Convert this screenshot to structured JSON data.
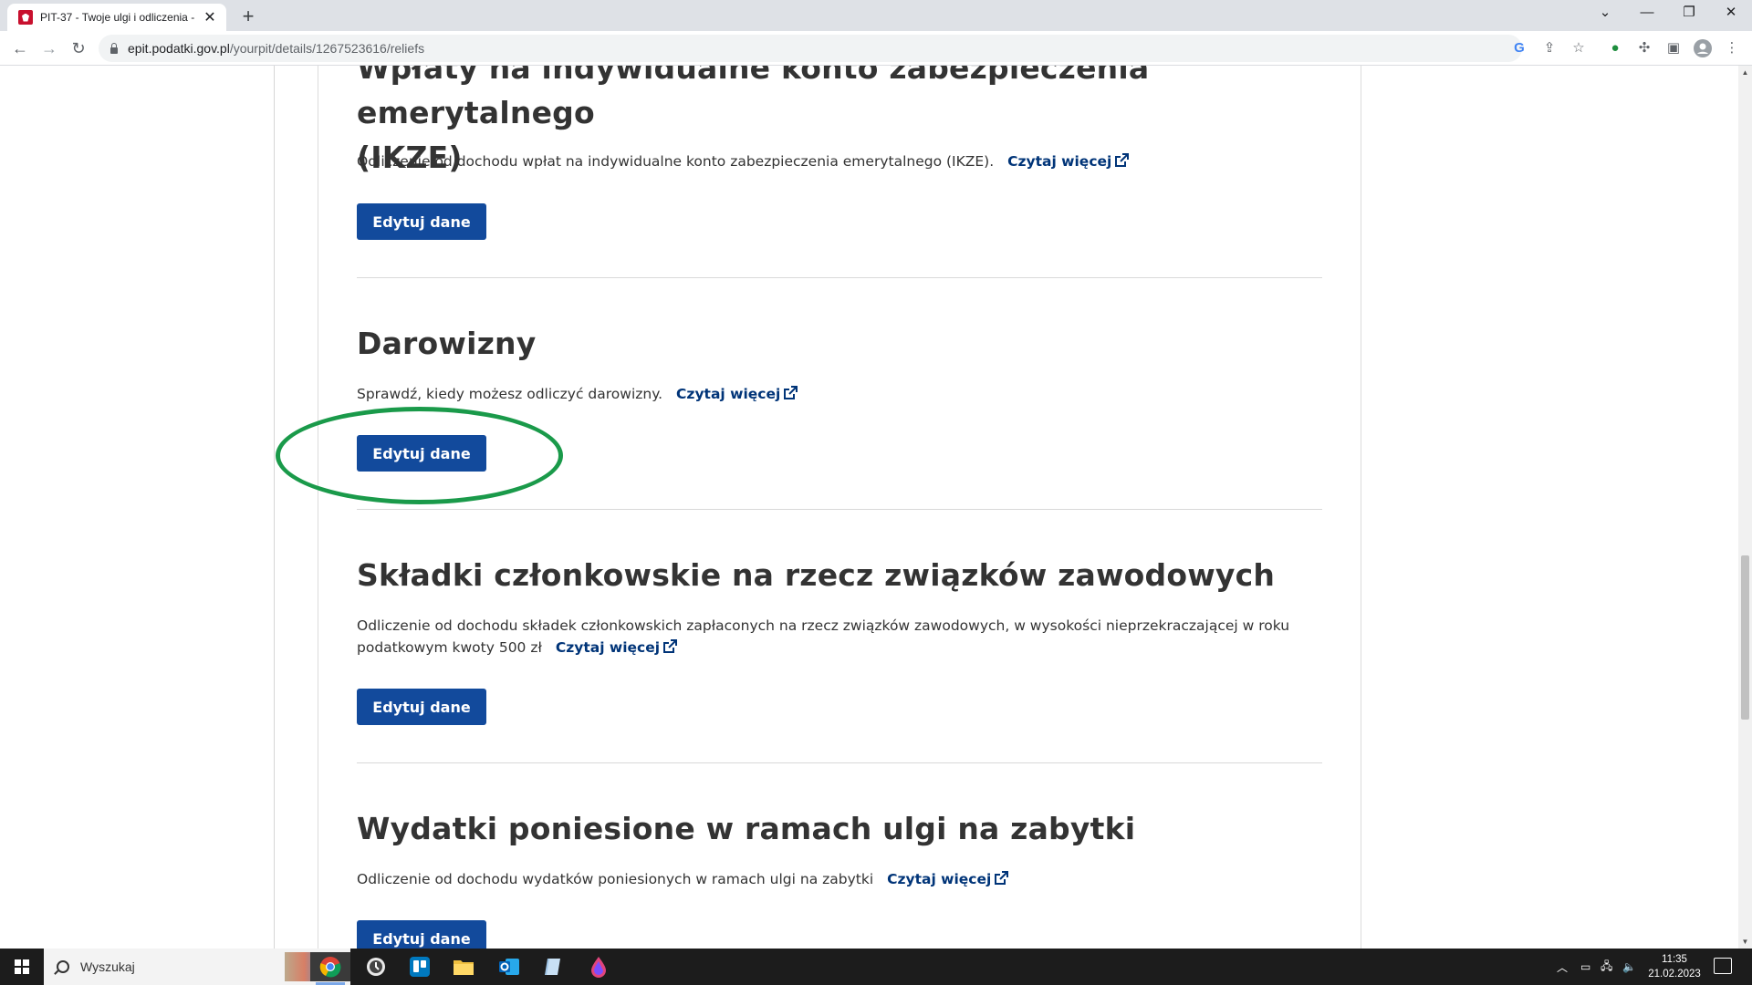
{
  "browser": {
    "tab_title": "PIT-37 - Twoje ulgi i odliczenia -",
    "tab_close": "✕",
    "new_tab": "+",
    "url_host": "epit.podatki.gov.pl",
    "url_path": "/yourpit/details/1267523616/reliefs"
  },
  "sections": [
    {
      "heading_line1": "Wpłaty na indywidualne konto zabezpieczenia emerytalnego",
      "heading_line2": "(IKZE)",
      "description": "Odliczenie od dochodu wpłat na indywidualne konto zabezpieczenia emerytalnego (IKZE).",
      "read_more": "Czytaj więcej",
      "button": "Edytuj dane"
    },
    {
      "heading": "Darowizny",
      "description": "Sprawdź, kiedy możesz odliczyć darowizny.",
      "read_more": "Czytaj więcej",
      "button": "Edytuj dane"
    },
    {
      "heading": "Składki członkowskie na rzecz związków zawodowych",
      "description_line1": "Odliczenie od dochodu składek członkowskich zapłaconych na rzecz związków zawodowych, w wysokości nieprzekraczającej w roku",
      "description_line2": "podatkowym kwoty 500 zł",
      "read_more": "Czytaj więcej",
      "button": "Edytuj dane"
    },
    {
      "heading": "Wydatki poniesione w ramach ulgi na zabytki",
      "description": "Odliczenie od dochodu wydatków poniesionych w ramach ulgi na zabytki",
      "read_more": "Czytaj więcej",
      "button": "Edytuj dane"
    }
  ],
  "highlight_color": "#1a9a4a",
  "accent_color": "#124a9c",
  "link_color": "#003478",
  "taskbar": {
    "search_placeholder": "Wyszukaj",
    "time": "11:35",
    "date": "21.02.2023",
    "apps": [
      "chrome-icon",
      "clock-app-icon",
      "trello-icon",
      "file-explorer-icon",
      "outlook-icon",
      "notes-icon",
      "drop-app-icon"
    ]
  }
}
